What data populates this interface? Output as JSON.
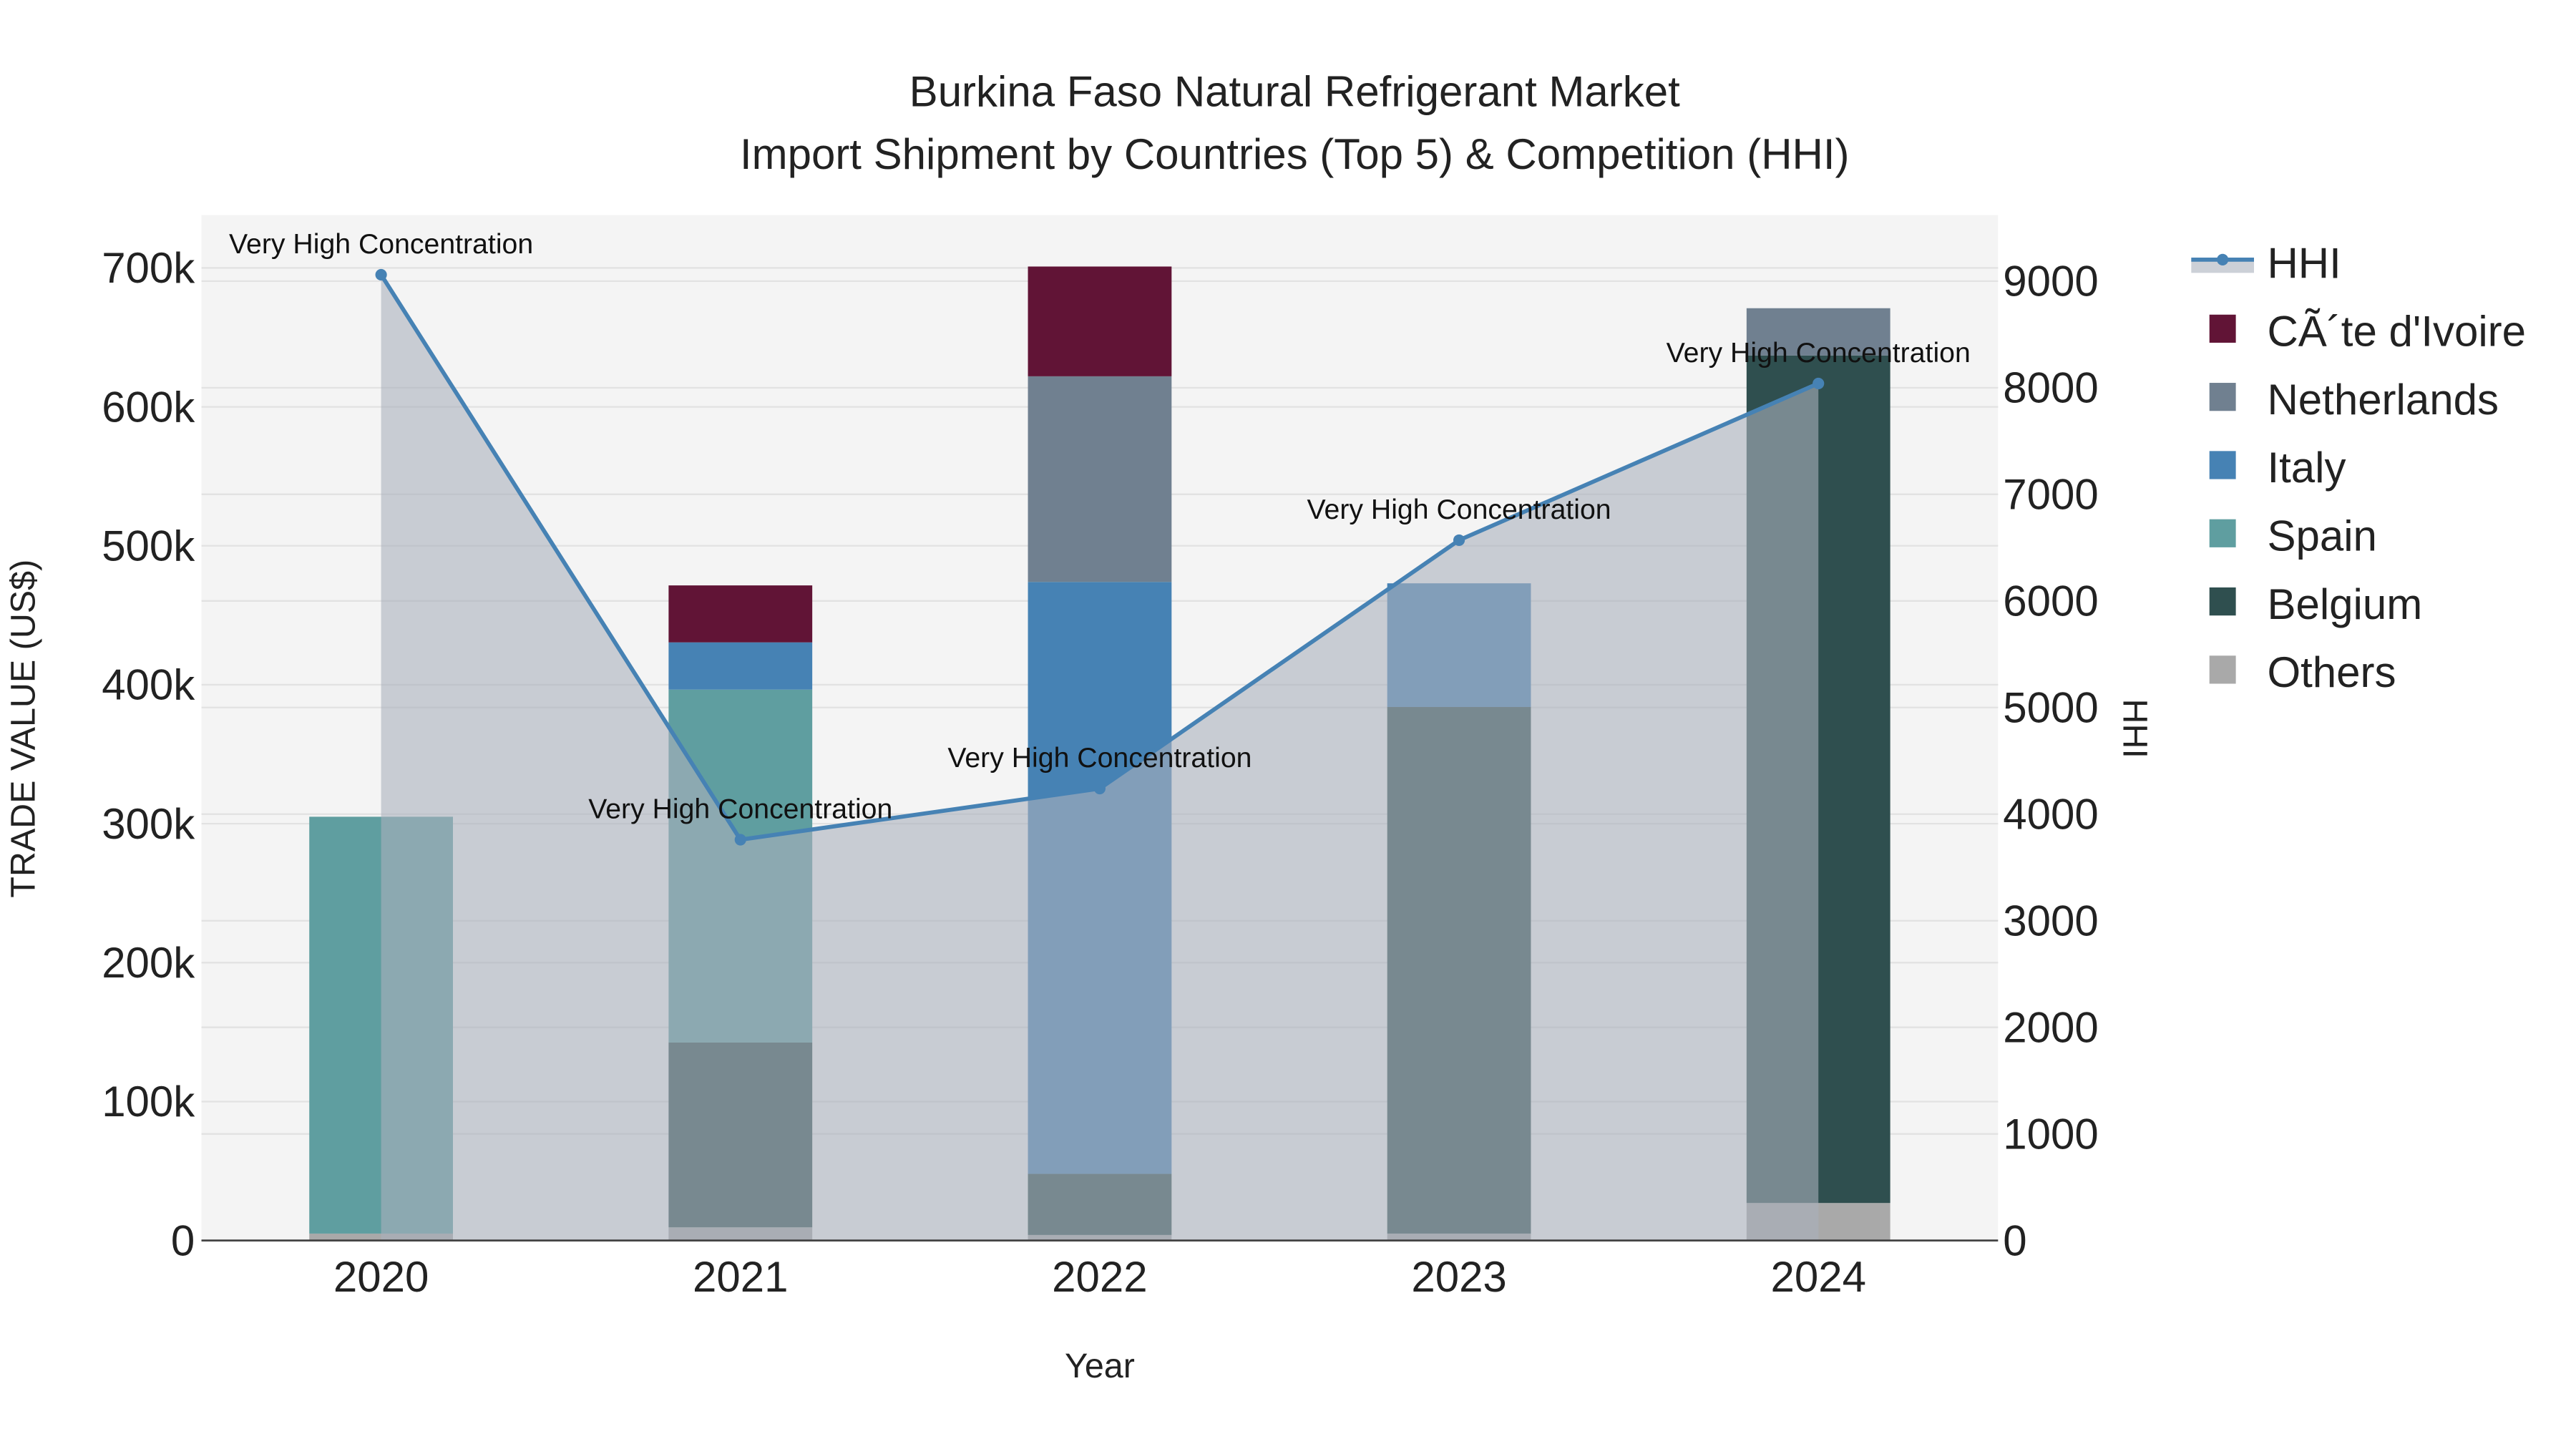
{
  "chart_data": {
    "type": "bar",
    "stacked": true,
    "title": "Burkina Faso Natural Refrigerant Market",
    "subtitle": "Import Shipment by Countries (Top 5) & Competition (HHI)",
    "xlabel": "Year",
    "ylabel": "TRADE VALUE (US$)",
    "y2label": "HHI",
    "categories": [
      "2020",
      "2021",
      "2022",
      "2023",
      "2024"
    ],
    "ylim": [
      0,
      735000
    ],
    "y2lim": [
      0,
      9600
    ],
    "yticks": [
      0,
      100000,
      200000,
      300000,
      400000,
      500000,
      600000,
      700000
    ],
    "ytick_labels": [
      "0",
      "100k",
      "200k",
      "300k",
      "400k",
      "500k",
      "600k",
      "700k"
    ],
    "y2ticks": [
      0,
      1000,
      2000,
      3000,
      4000,
      5000,
      6000,
      7000,
      8000,
      9000
    ],
    "y2tick_labels": [
      "0",
      "1000",
      "2000",
      "3000",
      "4000",
      "5000",
      "6000",
      "7000",
      "8000",
      "9000"
    ],
    "grid": true,
    "legend_position": "right",
    "series": [
      {
        "name": "Others",
        "color": "#A9A9A9",
        "values": [
          5000,
          9500,
          4000,
          5000,
          27000
        ]
      },
      {
        "name": "Belgium",
        "color": "#2F4F4F",
        "values": [
          0,
          133000,
          44000,
          379000,
          610000
        ]
      },
      {
        "name": "Spain",
        "color": "#5F9EA0",
        "values": [
          300000,
          254000,
          0,
          0,
          0
        ]
      },
      {
        "name": "Italy",
        "color": "#4682B4",
        "values": [
          0,
          34000,
          426000,
          89000,
          0
        ]
      },
      {
        "name": "Netherlands",
        "color": "#708090",
        "values": [
          0,
          0,
          148000,
          0,
          34000
        ]
      },
      {
        "name": "CÃ´te d'Ivoire",
        "color": "#611436",
        "values": [
          0,
          41000,
          79000,
          0,
          0
        ]
      }
    ],
    "hhi": {
      "name": "HHI",
      "color": "#4682B4",
      "values": [
        9060,
        3760,
        4240,
        6570,
        8040
      ],
      "annotations": [
        "Very High Concentration",
        "Very High Concentration",
        "Very High Concentration",
        "Very High Concentration",
        "Very High Concentration"
      ]
    },
    "legend_order": [
      "HHI",
      "CÃ´te d'Ivoire",
      "Netherlands",
      "Italy",
      "Spain",
      "Belgium",
      "Others"
    ]
  }
}
